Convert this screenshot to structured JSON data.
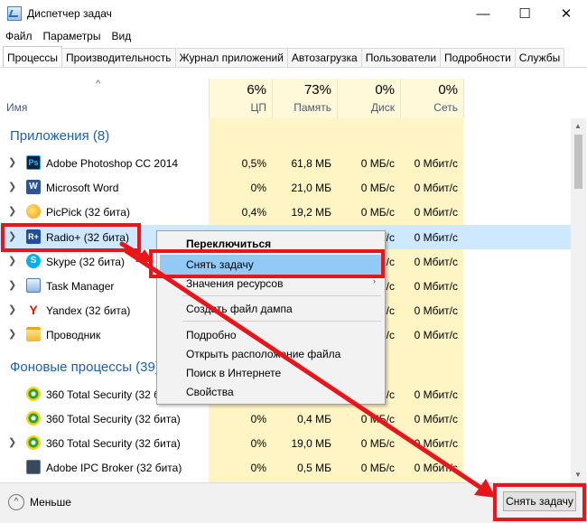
{
  "window": {
    "title": "Диспетчер задач",
    "controls": {
      "minimize": "—",
      "maximize": "☐",
      "close": "✕"
    }
  },
  "menu": [
    "Файл",
    "Параметры",
    "Вид"
  ],
  "tabs": [
    "Процессы",
    "Производительность",
    "Журнал приложений",
    "Автозагрузка",
    "Пользователи",
    "Подробности",
    "Службы"
  ],
  "active_tab": 0,
  "columns": {
    "name": "Имя",
    "cpu": {
      "percent": "6%",
      "label": "ЦП"
    },
    "memory": {
      "percent": "73%",
      "label": "Память"
    },
    "disk": {
      "percent": "0%",
      "label": "Диск"
    },
    "network": {
      "percent": "0%",
      "label": "Сеть"
    },
    "sort_arrow": "^"
  },
  "groups": {
    "apps": "Приложения (8)",
    "background": "Фоновые процессы (39)"
  },
  "apps": [
    {
      "name": "Adobe Photoshop CC 2014",
      "icon": "photoshop-icon",
      "cpu": "0,5%",
      "mem": "61,8 МБ",
      "disk": "0 МБ/с",
      "net": "0 Мбит/с"
    },
    {
      "name": "Microsoft Word",
      "icon": "word-icon",
      "cpu": "0%",
      "mem": "21,0 МБ",
      "disk": "0 МБ/с",
      "net": "0 Мбит/с"
    },
    {
      "name": "PicPick (32 бита)",
      "icon": "picpick-icon",
      "cpu": "0,4%",
      "mem": "19,2 МБ",
      "disk": "0 МБ/с",
      "net": "0 Мбит/с"
    },
    {
      "name": "Radio+ (32 бита)",
      "icon": "radio-icon",
      "cpu": "",
      "mem": "",
      "disk": "/с",
      "net": "0 Мбит/с"
    },
    {
      "name": "Skype (32 бита)",
      "icon": "skype-icon",
      "cpu": "",
      "mem": "",
      "disk": "/с",
      "net": "0 Мбит/с"
    },
    {
      "name": "Task Manager",
      "icon": "task-manager-icon",
      "cpu": "",
      "mem": "",
      "disk": "/с",
      "net": "0 Мбит/с"
    },
    {
      "name": "Yandex (32 бита)",
      "icon": "yandex-icon",
      "cpu": "",
      "mem": "",
      "disk": "/с",
      "net": "0 Мбит/с"
    },
    {
      "name": "Проводник",
      "icon": "folder-icon",
      "cpu": "",
      "mem": "",
      "disk": "/с",
      "net": "0 Мбит/с"
    }
  ],
  "background": [
    {
      "name": "360 Total Security (32 бита)",
      "icon": "360-icon",
      "cpu": "",
      "mem": "",
      "disk": "/с",
      "net": "0 Мбит/с",
      "expand": false
    },
    {
      "name": "360 Total Security (32 бита)",
      "icon": "360-icon",
      "cpu": "0%",
      "mem": "0,4 МБ",
      "disk": "0 МБ/с",
      "net": "0 Мбит/с",
      "expand": false
    },
    {
      "name": "360 Total Security (32 бита)",
      "icon": "360-icon",
      "cpu": "0%",
      "mem": "19,0 МБ",
      "disk": "0 МБ/с",
      "net": "0 Мбит/с",
      "expand": true
    },
    {
      "name": "Adobe IPC Broker (32 бита)",
      "icon": "adobe-ipc-icon",
      "cpu": "0%",
      "mem": "0,5 МБ",
      "disk": "0 МБ/с",
      "net": "0 Мбит/с",
      "expand": false
    }
  ],
  "context_menu": {
    "items": [
      "Переключиться",
      "Снять задачу",
      "Значения ресурсов",
      "Создать файл дампа",
      "Подробно",
      "Открыть расположение файла",
      "Поиск в Интернете",
      "Свойства"
    ],
    "submenu_arrow": "›"
  },
  "footer": {
    "less_label": "Меньше",
    "less_icon": "^",
    "end_task": "Снять задачу"
  },
  "colors": {
    "accent_blue": "#1e5fa8",
    "heat_light": "#fff4c4",
    "heat_header": "#fff8d9",
    "selection": "#cde8ff",
    "menu_highlight": "#91c9f7",
    "annotation_red": "#e8151b"
  }
}
